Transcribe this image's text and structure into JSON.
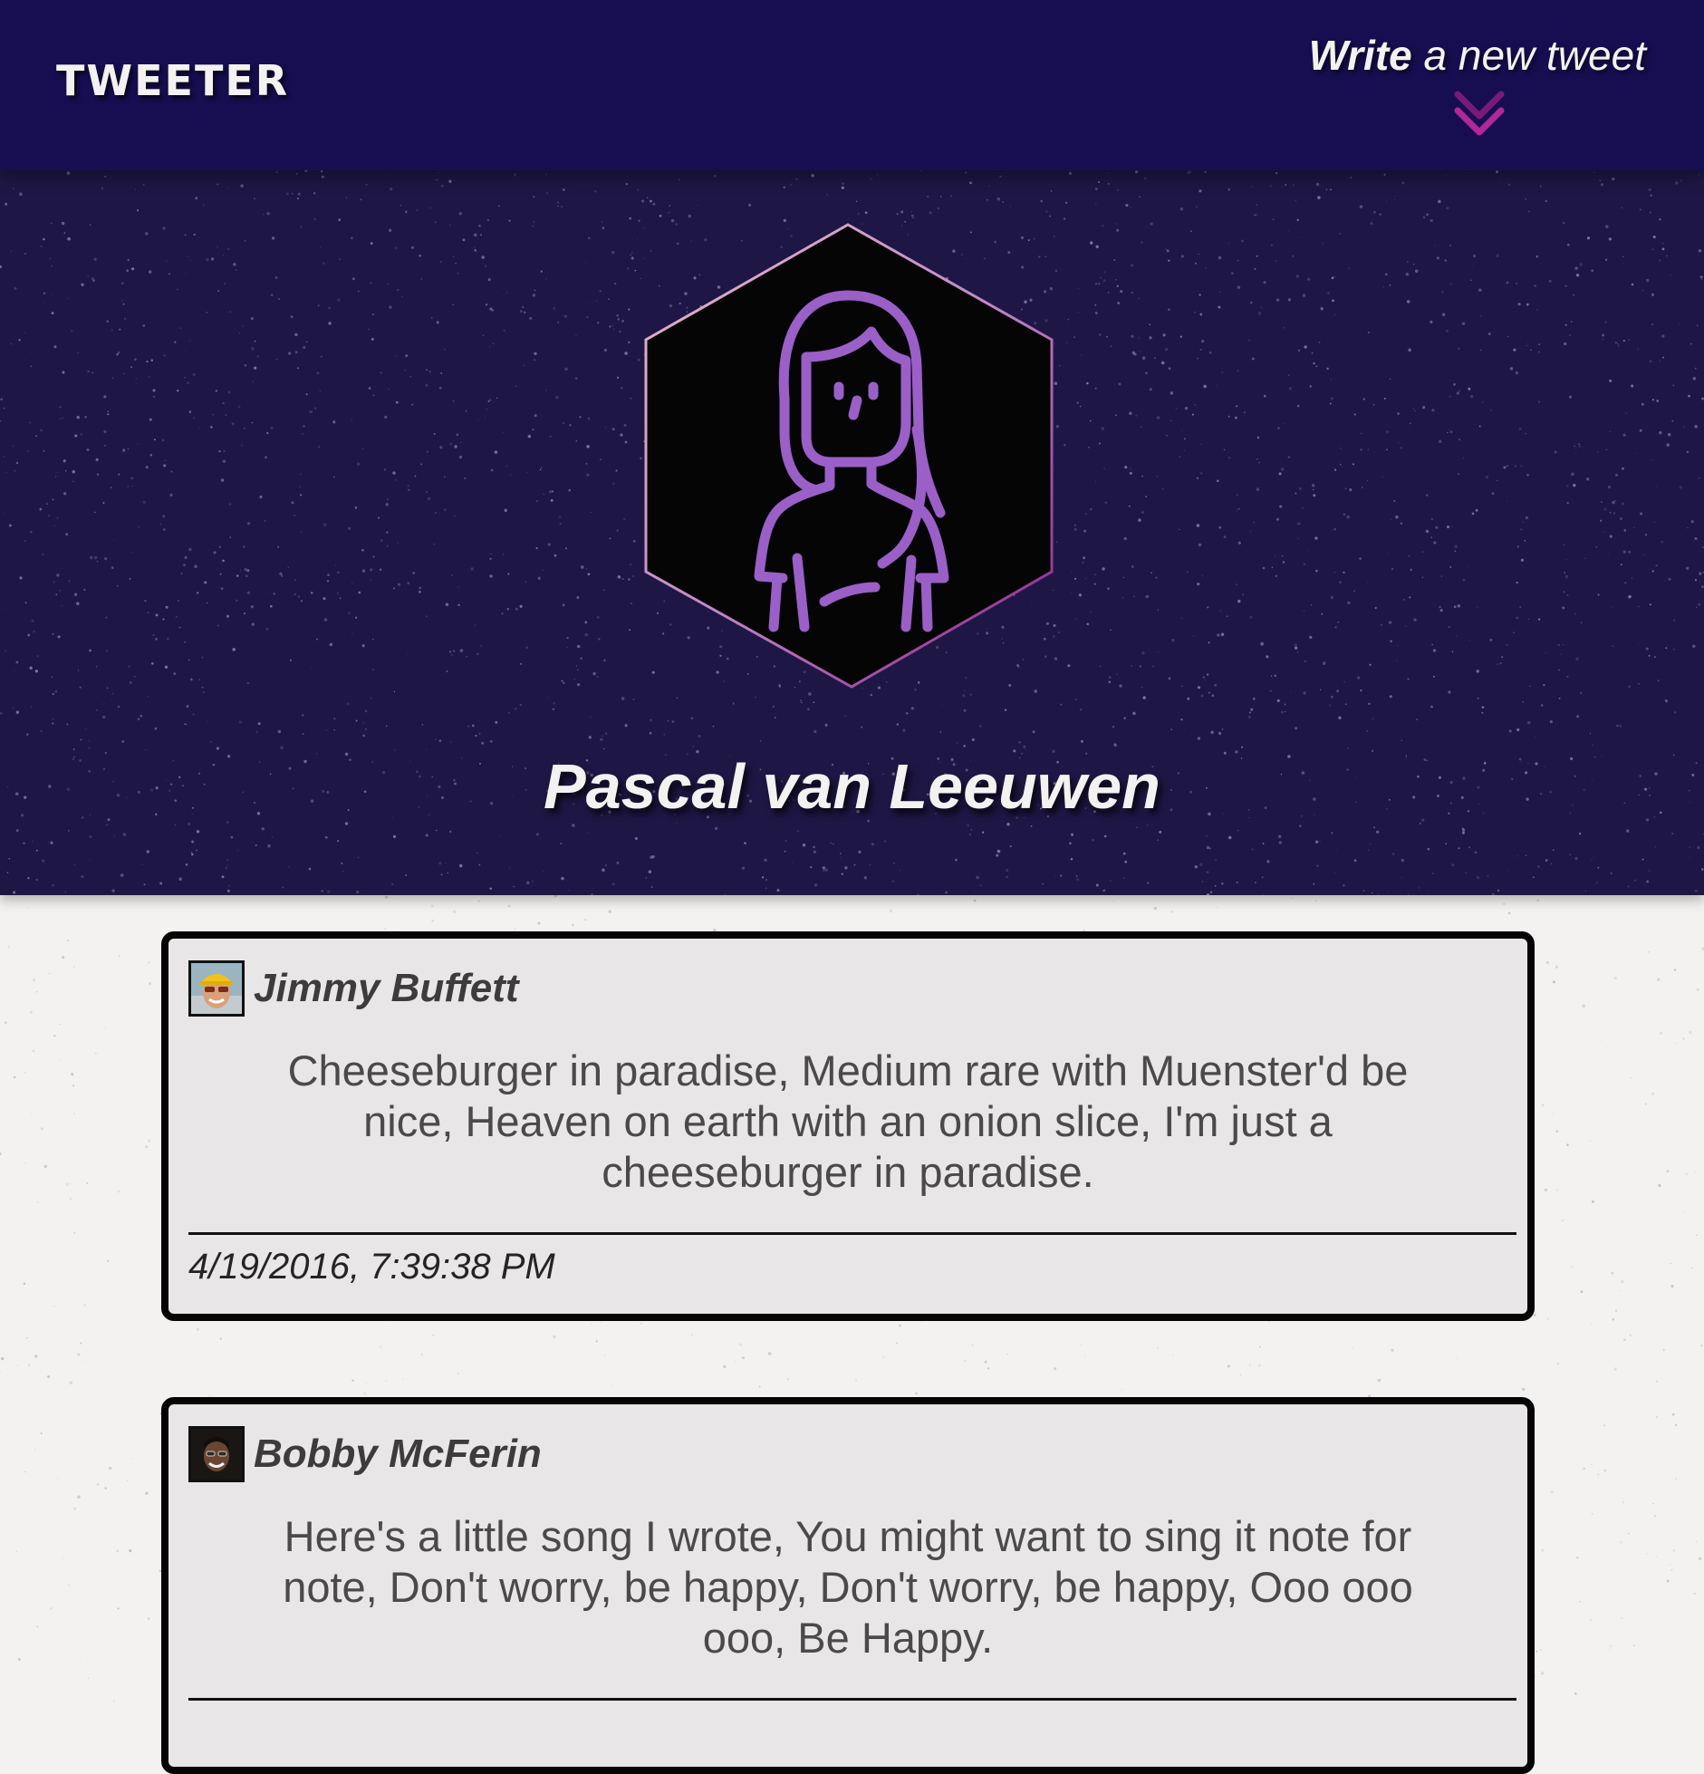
{
  "nav": {
    "logo": "TWEETER",
    "compose_strong": "Write",
    "compose_rest": " a new tweet",
    "compose_icon": "double-chevron-down-icon"
  },
  "profile": {
    "name": "Pascal van Leeuwen",
    "avatar_icon": "woman-portrait-hexagon-avatar"
  },
  "tweets": [
    {
      "author": "Jimmy Buffett",
      "text": "Cheeseburger in paradise, Medium rare with Muenster'd be nice, Heaven on earth with an onion slice, I'm just a cheeseburger in paradise.",
      "timestamp": "4/19/2016, 7:39:38 PM"
    },
    {
      "author": "Bobby McFerin",
      "text": "Here's a little song I wrote, You might want to sing it note for note, Don't worry, be happy, Don't worry, be happy, Ooo ooo ooo, Be Happy."
    }
  ],
  "colors": {
    "nav_bg": "#170e52",
    "header_bg": "#1e1745",
    "accent": "#9b5fc8",
    "chevron": "#b0279a",
    "page_bg": "#f4f2f0",
    "card_bg": "#e8e6e7"
  }
}
